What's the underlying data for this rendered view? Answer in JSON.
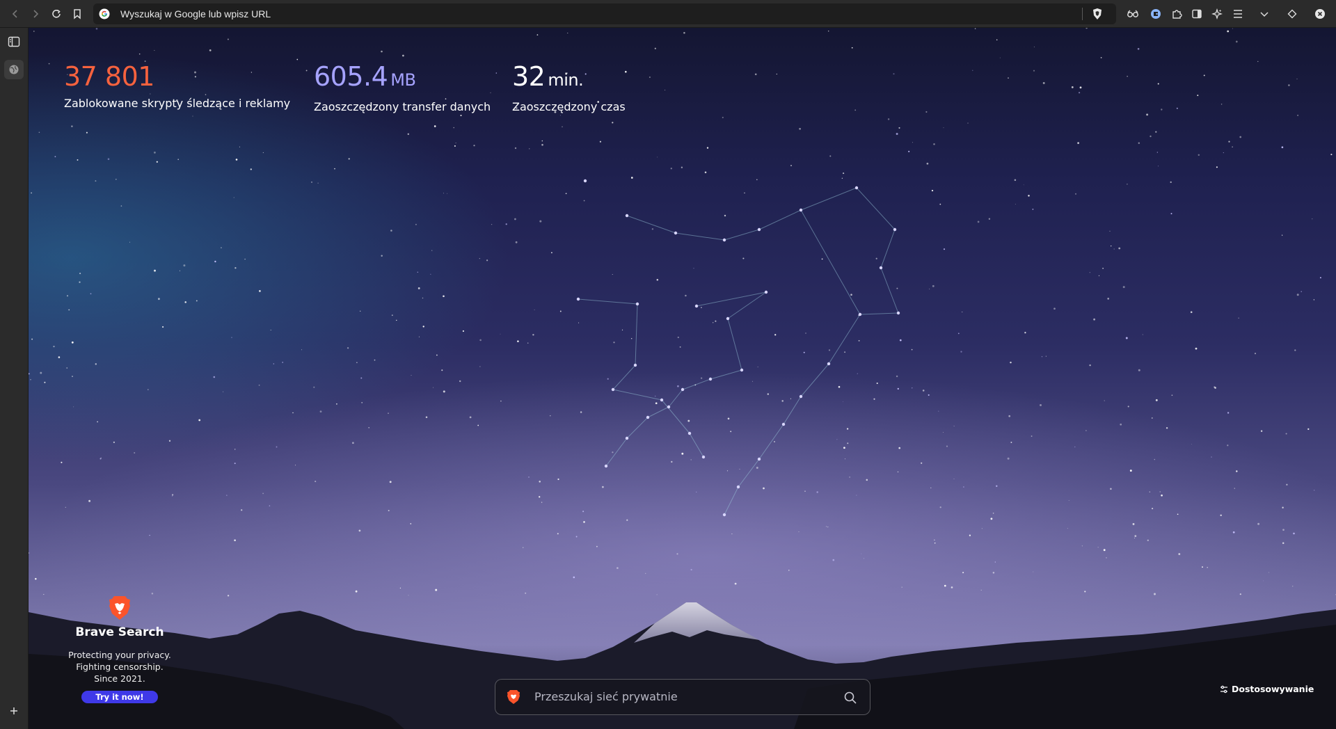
{
  "toolbar": {
    "url_placeholder": "Wyszukaj w Google lub wpisz URL",
    "icons": [
      "back-icon",
      "forward-icon",
      "reload-icon",
      "bookmark-icon",
      "google-icon",
      "brave-shield-icon",
      "vpn-icon",
      "wallet-icon",
      "extensions-icon",
      "sidepanel-icon",
      "leo-ai-icon",
      "menu-icon",
      "chevron-down-icon",
      "brave-rewards-icon",
      "close-icon"
    ]
  },
  "sidebar": {
    "icons": [
      "sidebar-toggle-icon",
      "globe-icon",
      "add-icon"
    ]
  },
  "stats": {
    "trackers": {
      "value": "37 801",
      "label": "Zablokowane skrypty śledzące i reklamy",
      "color": "#f6623e"
    },
    "bandwidth": {
      "value": "605.4",
      "unit": "MB",
      "label": "Zaoszczędzony transfer danych",
      "color": "#a6a3ff"
    },
    "time": {
      "value": "32",
      "unit": "min.",
      "label": "Zaoszczędzony czas",
      "color": "#ffffff"
    }
  },
  "promo": {
    "title": "Brave Search",
    "line1": "Protecting your privacy.",
    "line2": "Fighting censorship.",
    "line3": "Since 2021.",
    "cta": "Try it now!"
  },
  "search": {
    "placeholder": "Przeszukaj sieć prywatnie"
  },
  "customize": {
    "label": "Dostosowywanie"
  },
  "colors": {
    "toolbar": "#2b2b2b",
    "accent": "#3f39e8",
    "brave_orange": "#fb542b"
  }
}
